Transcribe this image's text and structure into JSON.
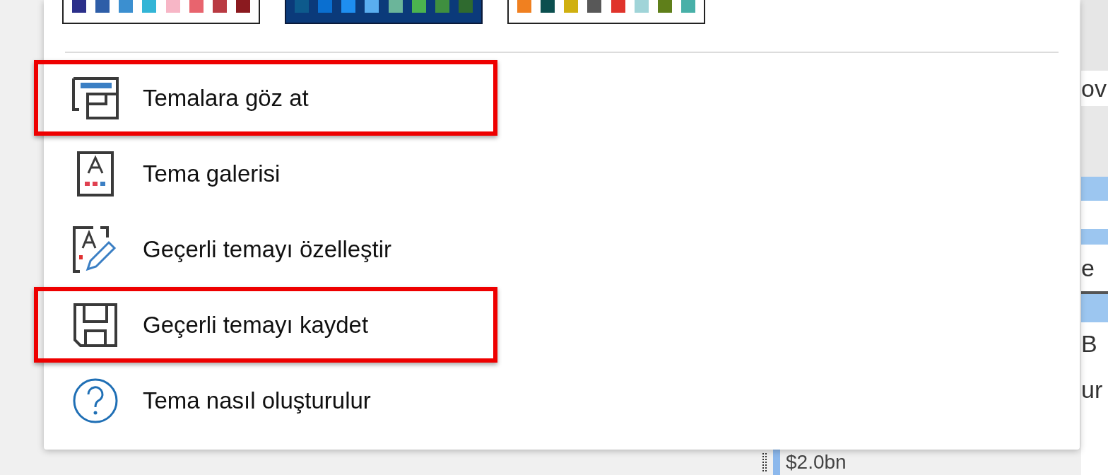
{
  "theme_swatches": [
    {
      "dark": false,
      "swatches": [
        {
          "color": "#2b2f8a"
        },
        {
          "color": "#2e5ea8"
        },
        {
          "color": "#3b8fd0"
        },
        {
          "color": "#33b5d6"
        },
        {
          "color": "#f7b6c6"
        },
        {
          "color": "#e8646e"
        },
        {
          "color": "#b93a42"
        },
        {
          "color": "#8b1a1f"
        }
      ]
    },
    {
      "dark": true,
      "swatches": [
        {
          "color": "#0d5a8c"
        },
        {
          "color": "#0a6fd0"
        },
        {
          "color": "#1e8ef0"
        },
        {
          "color": "#5aaef0"
        },
        {
          "color": "#6bb59a"
        },
        {
          "color": "#4bb34f"
        },
        {
          "color": "#3f8f3f"
        },
        {
          "color": "#2f6a2f"
        }
      ]
    },
    {
      "dark": false,
      "swatches": [
        {
          "color": "#f08020"
        },
        {
          "color": "#0b4f4f"
        },
        {
          "color": "#d0b010"
        },
        {
          "color": "#585858"
        },
        {
          "color": "#e0332b"
        },
        {
          "color": "#a0d4d8"
        },
        {
          "color": "#5f7f1a"
        },
        {
          "color": "#48b0a8"
        }
      ]
    }
  ],
  "menu_items": [
    {
      "label": "Temalara göz at",
      "kind": "browse",
      "highlighted": true
    },
    {
      "label": "Tema galerisi",
      "kind": "gallery",
      "highlighted": false
    },
    {
      "label": "Geçerli temayı özelleştir",
      "kind": "customize",
      "highlighted": false
    },
    {
      "label": "Geçerli temayı kaydet",
      "kind": "save",
      "highlighted": true
    },
    {
      "label": "Tema nasıl oluşturulur",
      "kind": "help",
      "highlighted": false
    }
  ],
  "background": {
    "right_texts": [
      "ov",
      "e",
      "B",
      "ur"
    ],
    "value": "$2.0bn"
  }
}
